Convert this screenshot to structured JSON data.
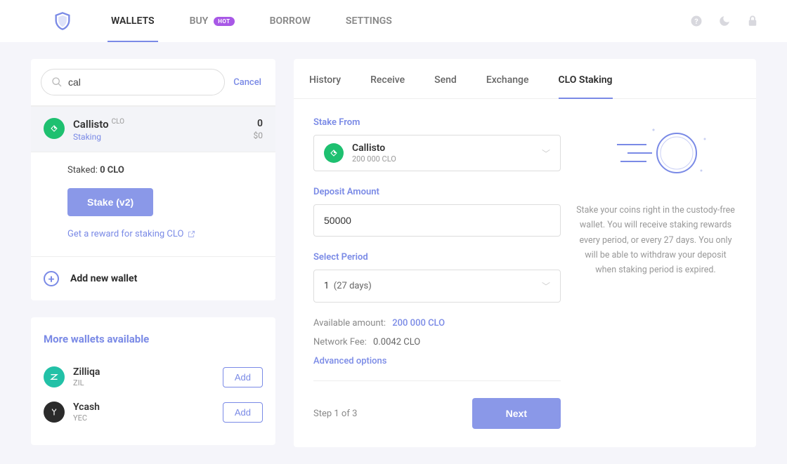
{
  "nav": {
    "items": [
      "WALLETS",
      "BUY",
      "BORROW",
      "SETTINGS"
    ],
    "hot": "HOT"
  },
  "search": {
    "value": "cal",
    "cancel": "Cancel"
  },
  "wallet": {
    "name": "Callisto",
    "ticker": "CLO",
    "sub": "Staking",
    "balance": "0",
    "fiat": "$0"
  },
  "stake": {
    "staked_label": "Staked: ",
    "staked_value": "0 CLO",
    "button": "Stake (v2)",
    "reward_link": "Get a reward for staking CLO"
  },
  "add_wallet": "Add new wallet",
  "more": {
    "title": "More wallets available",
    "items": [
      {
        "name": "Zilliqa",
        "ticker": "ZIL"
      },
      {
        "name": "Ycash",
        "ticker": "YEC"
      }
    ],
    "add": "Add"
  },
  "tabs": [
    "History",
    "Receive",
    "Send",
    "Exchange",
    "CLO Staking"
  ],
  "form": {
    "stake_from_label": "Stake From",
    "from_name": "Callisto",
    "from_sub": "200 000 CLO",
    "deposit_label": "Deposit Amount",
    "deposit_value": "50000",
    "period_label": "Select Period",
    "period_num": "1",
    "period_days": "(27 days)",
    "available_label": "Available amount:",
    "available_value": "200 000 CLO",
    "fee_label": "Network Fee:",
    "fee_value": "0.0042 CLO",
    "advanced": "Advanced options",
    "step": "Step 1 of 3",
    "next": "Next"
  },
  "info": "Stake your coins right in the custody-free wallet. You will receive staking rewards every period, or every 27 days. You only will be able to withdraw your deposit when staking period is expired."
}
